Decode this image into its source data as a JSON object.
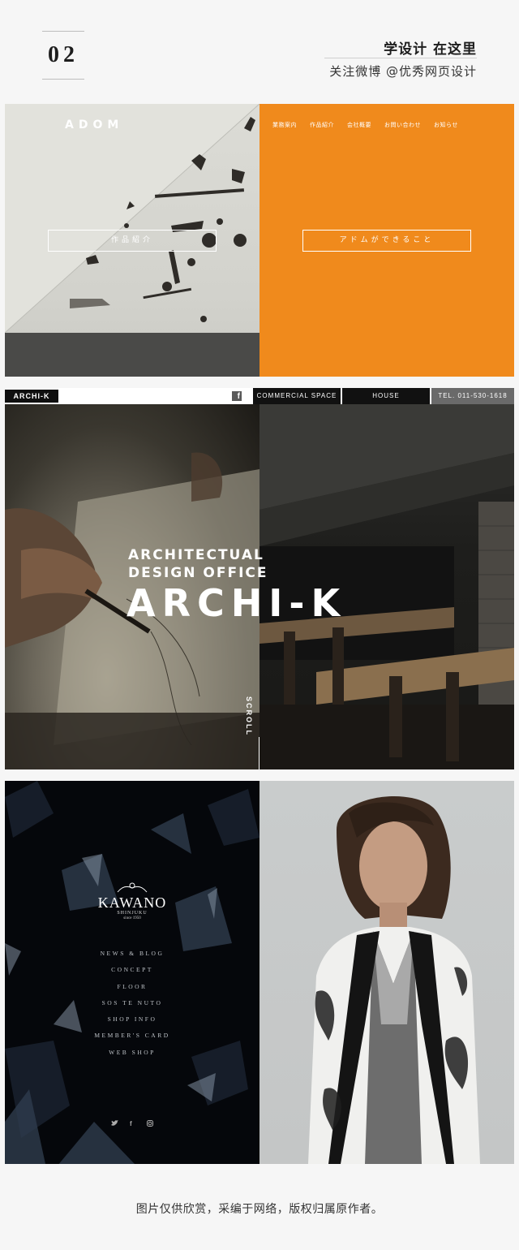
{
  "header": {
    "number": "02",
    "title": "学设计 在这里",
    "subtitle": "关注微博 @优秀网页设计"
  },
  "adom": {
    "logo": "ADOM",
    "nav": [
      "業務案内",
      "作品紹介",
      "会社概要",
      "お問い合わせ",
      "お知らせ"
    ],
    "left_button": "作品紹介",
    "right_button": "アドムができること",
    "accent_color": "#f08a1c"
  },
  "archik": {
    "logo": "ARCHI-K",
    "social_icon": "facebook-icon",
    "tabs": [
      "COMMERCIAL SPACE",
      "HOUSE"
    ],
    "tel": "TEL. 011-530-1618",
    "hero_sub_1": "ARCHITECTUAL",
    "hero_sub_2": "DESIGN OFFICE",
    "hero_title": "ARCHI-K",
    "scroll": "SCROLL"
  },
  "kawano": {
    "name": "KAWANO",
    "location": "SHINJUKU",
    "since": "since 1950",
    "menu": [
      "NEWS & BLOG",
      "CONCEPT",
      "FLOOR",
      "SOS TE NUTO",
      "SHOP INFO",
      "MEMBER'S CARD",
      "WEB SHOP"
    ],
    "social": [
      "twitter-icon",
      "facebook-icon",
      "instagram-icon"
    ]
  },
  "footer": {
    "caption": "图片仅供欣赏，采编于网络，版权归属原作者。"
  }
}
